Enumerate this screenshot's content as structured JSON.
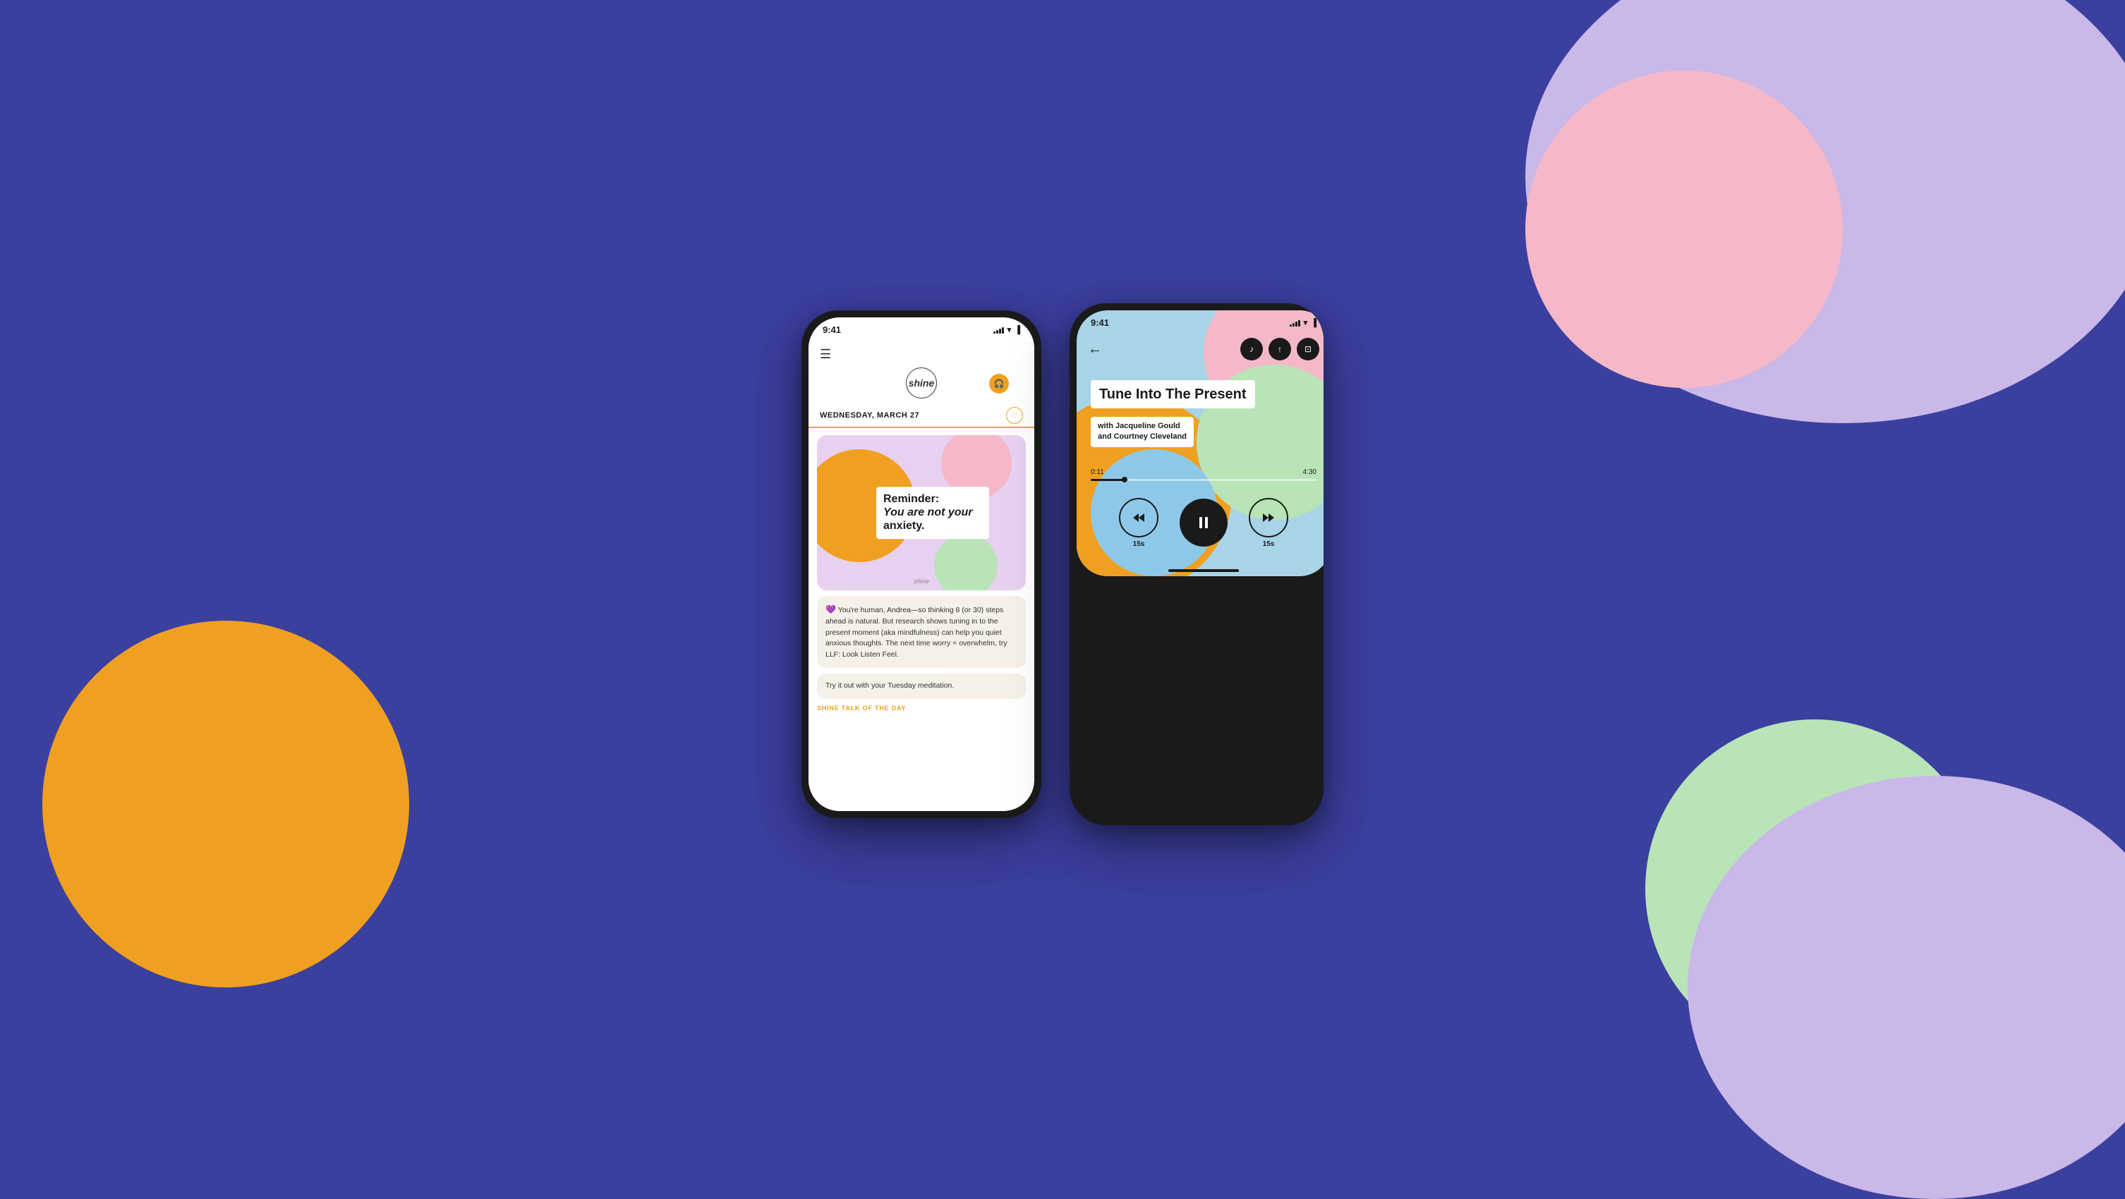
{
  "background": {
    "color": "#3b3f9e"
  },
  "left_phone": {
    "status_bar": {
      "time": "9:41",
      "signal": "signal",
      "wifi": "wifi",
      "battery": "battery"
    },
    "header": {
      "logo_text": "shine",
      "menu_label": "☰"
    },
    "date_bar": {
      "date": "WEDNESDAY, MARCH 27",
      "heart": "♡"
    },
    "featured_card": {
      "headline_line1": "Reminder:",
      "headline_line2": "You are not your",
      "headline_line3": "anxiety.",
      "watermark": "shine"
    },
    "bubble1": {
      "emoji": "💜",
      "text": "You're human, Andrea—so thinking 8 (or 30) steps ahead is natural. But research shows tuning in to the present moment (aka mindfulness) can help you quiet anxious thoughts. The next time worry = overwhelm, try LLF: Look Listen Feel."
    },
    "bubble2": {
      "text": "Try it out with your Tuesday meditation."
    },
    "shine_talk_label": "SHINE TALK OF THE DAY"
  },
  "right_phone": {
    "status_bar": {
      "time": "9:41",
      "signal": "signal",
      "wifi": "wifi",
      "battery": "battery"
    },
    "header": {
      "back_arrow": "←",
      "music_icon": "♪",
      "share_icon": "↑",
      "bookmark_icon": "⊡"
    },
    "audio": {
      "title": "Tune Into The Present",
      "subtitle_line1": "with Jacqueline Gould",
      "subtitle_line2": "and Courtney Cleveland",
      "time_current": "0:11",
      "time_total": "4:30",
      "progress_percent": 15
    },
    "controls": {
      "rewind_label": "15s",
      "pause_label": "⏸",
      "forward_label": "15s",
      "rewind_icon": "⏮",
      "forward_icon": "⏭"
    },
    "home_indicator": "home"
  }
}
